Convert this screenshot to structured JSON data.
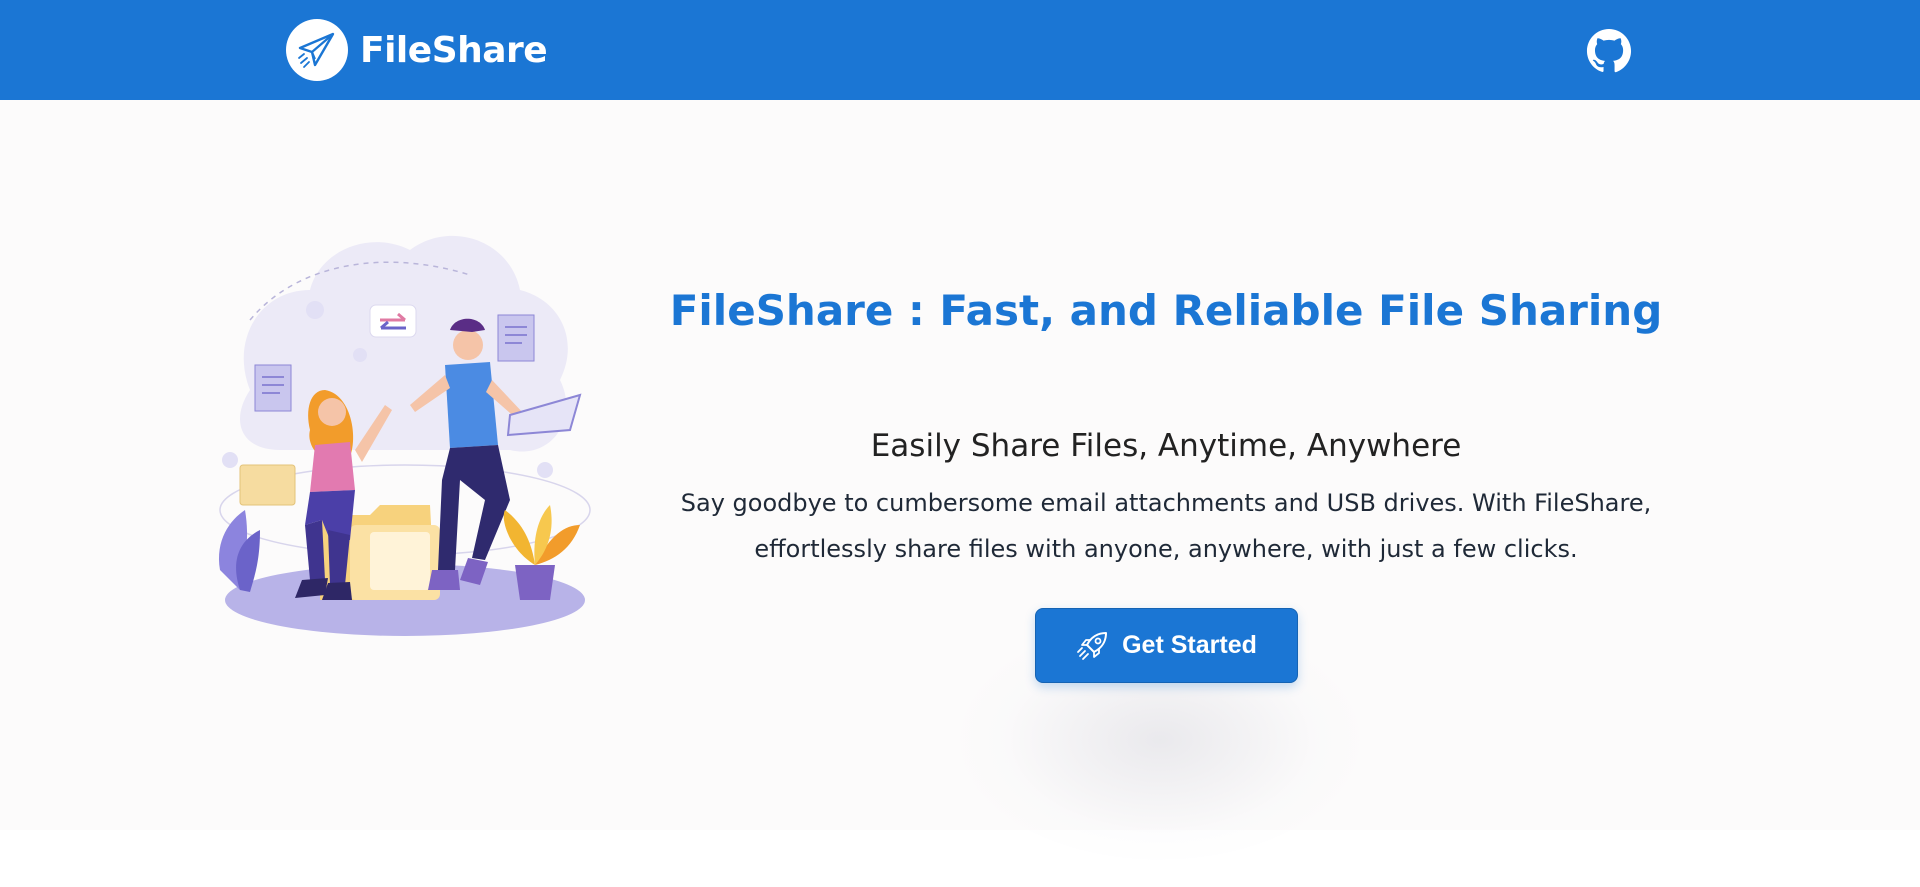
{
  "navbar": {
    "brand_name": "FileShare",
    "brand_logo_icon": "paper-plane-icon",
    "github_icon": "github-icon",
    "background_color": "#1b76d4"
  },
  "hero": {
    "illustration": "people-high-five-file-sharing-illustration",
    "title": "FileShare : Fast, and Reliable File Sharing",
    "subtitle": "Easily Share Files, Anytime, Anywhere",
    "description": "Say goodbye to cumbersome email attachments and USB drives. With FileShare, effortlessly share files with anyone, anywhere, with just a few clicks.",
    "cta": {
      "label": "Get Started",
      "icon": "rocket-icon"
    },
    "accent_color": "#1b76d4"
  }
}
